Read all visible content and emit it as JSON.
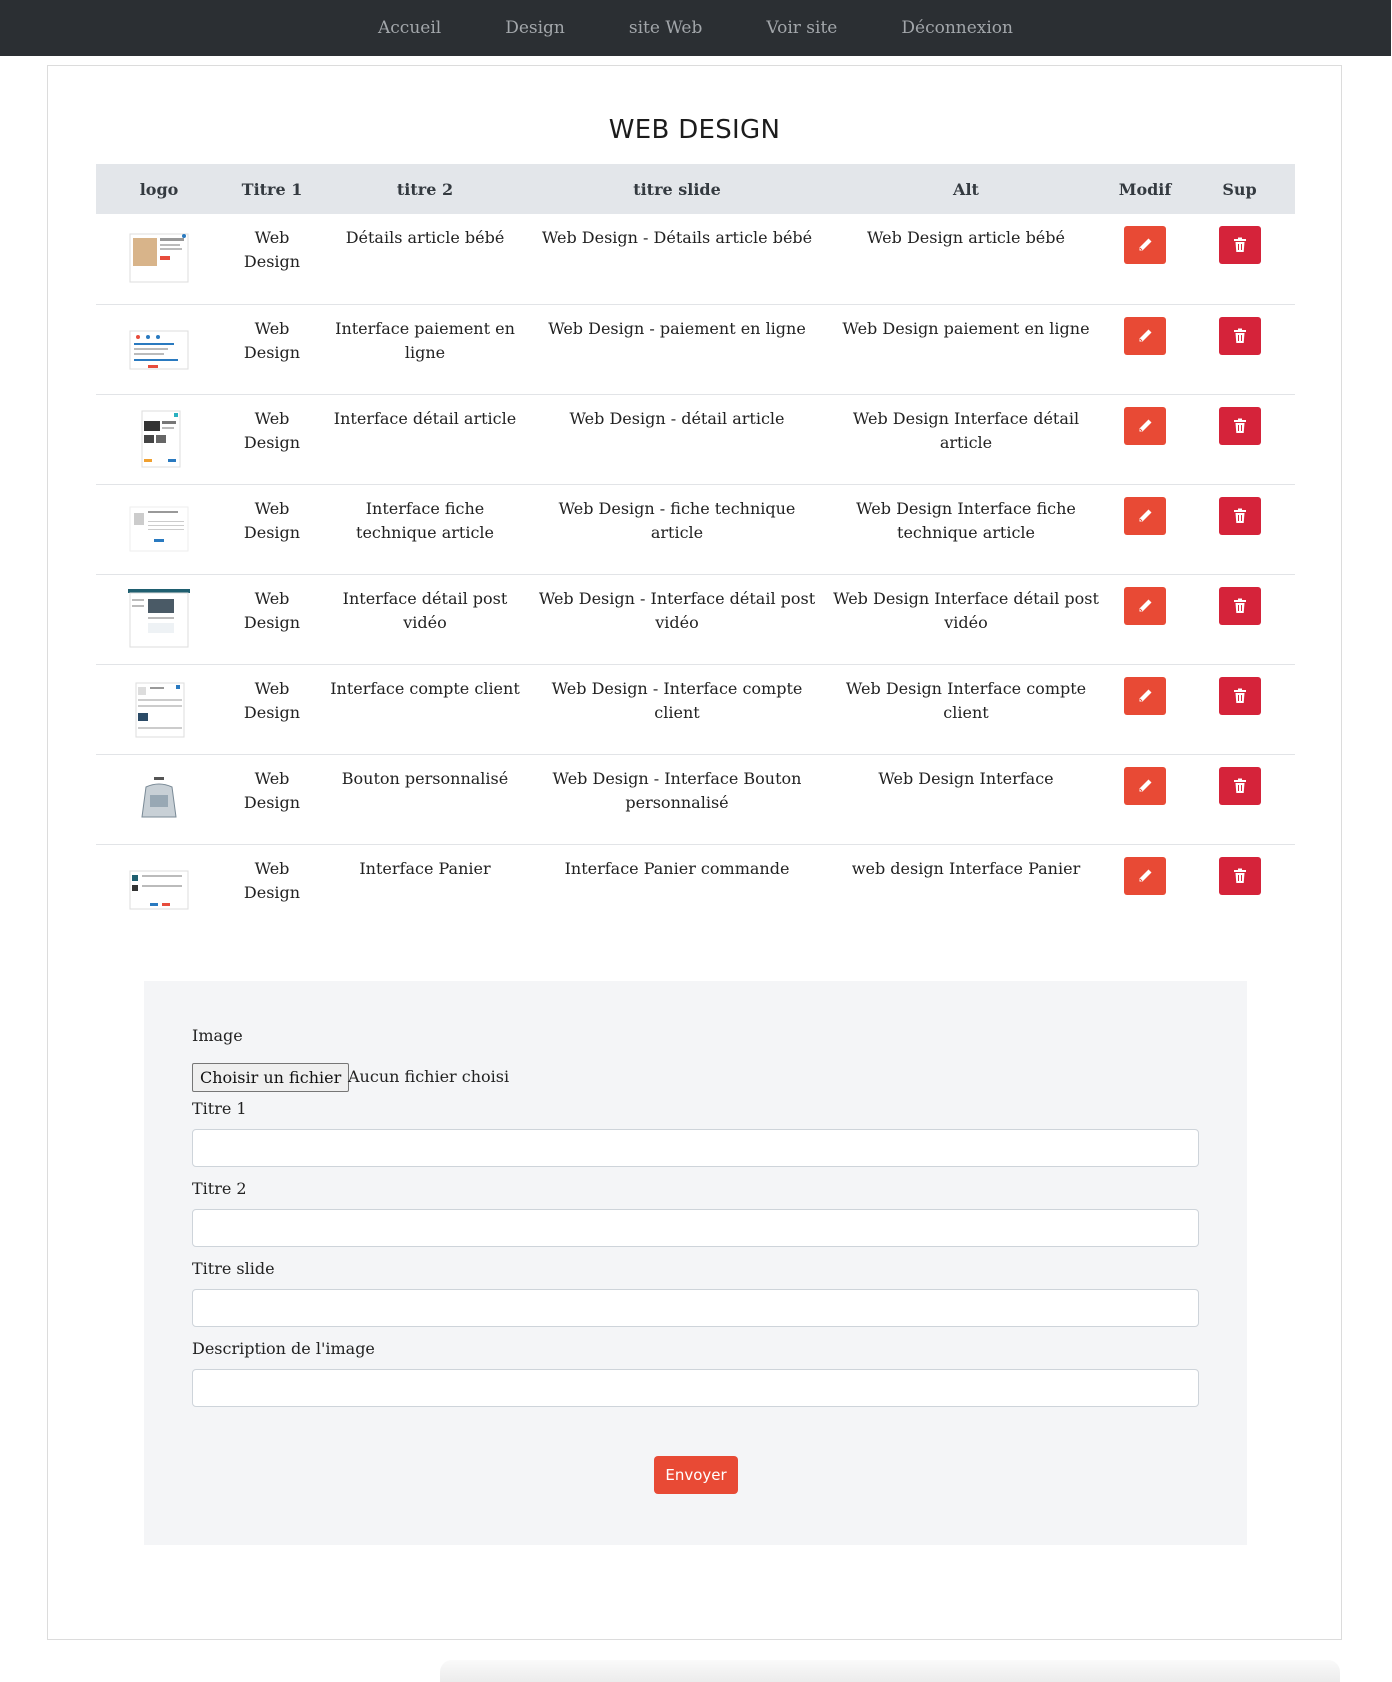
{
  "nav": {
    "items": [
      "Accueil",
      "Design",
      "site Web",
      "Voir site",
      "Déconnexion"
    ]
  },
  "page": {
    "title": "WEB DESIGN"
  },
  "table": {
    "headers": [
      "logo",
      "Titre 1",
      "titre 2",
      "titre slide",
      "Alt",
      "Modif",
      "Sup"
    ],
    "rows": [
      {
        "titre1": "Web Design",
        "titre2": "Détails article bébé",
        "slide": "Web Design - Détails article bébé",
        "alt": "Web Design article bébé"
      },
      {
        "titre1": "Web Design",
        "titre2": "Interface paiement en ligne",
        "slide": "Web Design - paiement en ligne",
        "alt": "Web Design paiement en ligne"
      },
      {
        "titre1": "Web Design",
        "titre2": "Interface détail article",
        "slide": "Web Design - détail article",
        "alt": "Web Design Interface détail article"
      },
      {
        "titre1": "Web Design",
        "titre2": "Interface fiche technique article",
        "slide": "Web Design - fiche technique article",
        "alt": "Web Design Interface fiche technique article"
      },
      {
        "titre1": "Web Design",
        "titre2": "Interface détail post vidéo",
        "slide": "Web Design - Interface détail post vidéo",
        "alt": "Web Design Interface détail post vidéo"
      },
      {
        "titre1": "Web Design",
        "titre2": "Interface compte client",
        "slide": "Web Design - Interface compte client",
        "alt": "Web Design Interface compte client"
      },
      {
        "titre1": "Web Design",
        "titre2": "Bouton personnalisé",
        "slide": "Web Design - Interface Bouton personnalisé",
        "alt": "Web Design Interface"
      },
      {
        "titre1": "Web Design",
        "titre2": "Interface Panier",
        "slide": "Interface Panier commande",
        "alt": "web design Interface Panier"
      }
    ],
    "edit_icon": "pencil-icon",
    "delete_icon": "trash-icon"
  },
  "form": {
    "image_label": "Image",
    "file_button": "Choisir un fichier",
    "file_status": "Aucun fichier choisi",
    "titre1_label": "Titre 1",
    "titre1_value": "",
    "titre2_label": "Titre 2",
    "titre2_value": "",
    "slide_label": "Titre slide",
    "slide_value": "",
    "desc_label": "Description de l'image",
    "desc_value": "",
    "submit_label": "Envoyer"
  },
  "colors": {
    "navbar": "#2b2f33",
    "edit_button": "#e84a35",
    "delete_button": "#d5233a",
    "submit_button": "#e84a35"
  }
}
